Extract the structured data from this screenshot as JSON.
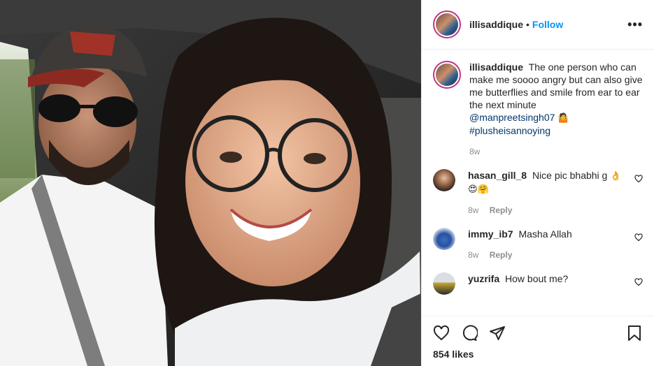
{
  "header": {
    "username": "illisaddique",
    "separator": "•",
    "follow_label": "Follow",
    "more_icon": "more-options-icon"
  },
  "caption": {
    "username": "illisaddique",
    "text": "The one person who can make me soooo angry but can also give me butterflies and smile from ear to ear the next minute",
    "mention": "@manpreetsingh07",
    "emoji": "🤷",
    "hashtag": "#plusheisannoying",
    "time": "8w"
  },
  "comments": [
    {
      "username": "hasan_gill_8",
      "text": "Nice pic bhabhi g",
      "emoji": "👌",
      "emoji_line": "😍🤗",
      "time": "8w",
      "reply_label": "Reply"
    },
    {
      "username": "immy_ib7",
      "text": "Masha Allah",
      "time": "8w",
      "reply_label": "Reply"
    },
    {
      "username": "yuzrifa",
      "text": "How bout me?"
    }
  ],
  "actions": {
    "like_icon": "heart-icon",
    "comment_icon": "comment-icon",
    "share_icon": "share-icon",
    "save_icon": "bookmark-icon",
    "likes": "854 likes"
  },
  "colors": {
    "accent": "#0095f6",
    "mention": "#00376b",
    "muted": "#8e8e8e",
    "text": "#262626",
    "border": "#efefef"
  }
}
